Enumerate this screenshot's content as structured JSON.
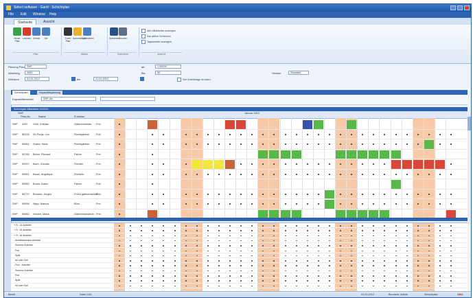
{
  "window": {
    "title": "Select software - Gantt - Schichtplan",
    "icon": "app-icon"
  },
  "menu": [
    "File",
    "Edit",
    "Window",
    "Help"
  ],
  "ribbon_tabs": [
    {
      "label": "Startseite",
      "active": true
    },
    {
      "label": "Ansicht",
      "active": false
    }
  ],
  "ribbon_buttons": [
    {
      "label": "Neuer Plan",
      "icon": "refresh-icon",
      "color": "#3aa14b"
    },
    {
      "label": "Löschen",
      "icon": "delete-icon",
      "color": "#d83b2b"
    },
    {
      "label": "Zurück",
      "icon": "back-arrow-icon",
      "color": "#4a7fc1"
    },
    {
      "label": "Vor",
      "icon": "forward-arrow-icon",
      "color": "#4a7fc1"
    },
    {
      "label": "Zoom Plan",
      "icon": "zoom-icon",
      "color": "#333333"
    },
    {
      "label": "Automatisch",
      "icon": "wand-icon",
      "color": "#e8b32a"
    },
    {
      "label": "Optimieren",
      "icon": "optimize-icon",
      "color": "#4a7fc1"
    },
    {
      "label": "Speichern",
      "icon": "save-icon",
      "color": "#2c4f86"
    },
    {
      "label": "Drucken",
      "icon": "print-icon",
      "color": "#5c6e88"
    }
  ],
  "ribbon_groups": [
    "Plan",
    "Aktion",
    "Speichern",
    "Ansicht"
  ],
  "ribbon_options": [
    "Alle Mitarbeiter anzeigen",
    "Nur aktive Schichten",
    "Tageswerte anzeigen"
  ],
  "fields": {
    "planname_label": "Planung Plan",
    "planname_value": "SHP",
    "abteilung_label": "Abteilung",
    "abteilung_value": "3460",
    "zeitraum_label": "Zeitraum",
    "zeitraum_from": "01.01.2012",
    "zeitraum_to": "31.01.2012",
    "bis_label": "bis",
    "ab_label": "ab",
    "ab_value": "1.09000",
    "bis2_label": "Bis",
    "bis2_value": "50",
    "checkbox_label": "Nur Arbeitstage drucken",
    "version_label": "Version",
    "version_value": "Standard"
  },
  "panel_tabs": [
    {
      "label": "Schichtplan",
      "active": true
    },
    {
      "label": "Kapazitätsplanung",
      "active": false
    }
  ],
  "filter": {
    "label": "Kapazitätsmodell",
    "value": "SHP-Ab"
  },
  "section_title": "Schichtplan Mitarbeiter 01/2012",
  "grid": {
    "group_label": "SHP",
    "columns": [
      "Pers-Nr.",
      "Name",
      "Funktion"
    ],
    "month_label": "Januar 2012",
    "rows": [
      {
        "grp": "SHP",
        "id": "4497",
        "name": "Grüll, Kristian",
        "role": "Gärtnermeister",
        "type": "Frei"
      },
      {
        "grp": "SHP",
        "id": "50109",
        "name": "Sh Pouja, Leo",
        "role": "Floristgärtner",
        "type": "Frei"
      },
      {
        "grp": "SHP",
        "id": "50681",
        "name": "Grabe, Hans",
        "role": "Floristgärtner",
        "type": "Frei"
      },
      {
        "grp": "SHP",
        "id": "50785",
        "name": "Bohm, Richard",
        "role": "Fahrer",
        "type": "Frei"
      },
      {
        "grp": "SHP",
        "id": "50937",
        "name": "Bach, Claudia",
        "role": "Floristin",
        "type": "Frei"
      },
      {
        "grp": "SHP",
        "id": "50951",
        "name": "Bauer, Angelique",
        "role": "Florist/in",
        "type": "Frei"
      },
      {
        "grp": "SHP",
        "id": "50952",
        "name": "Bruno, Adam",
        "role": "Fahrer",
        "type": "Frei"
      },
      {
        "grp": "SHP",
        "id": "50770",
        "name": "Brunner, Jürgen",
        "role": "Frei/a gärtnermeister",
        "type": "Frei"
      },
      {
        "grp": "SHP",
        "id": "50998",
        "name": "Wipp, Marcus",
        "role": "Büro",
        "type": "Frei"
      },
      {
        "grp": "SHP",
        "id": "50982",
        "name": "Heinen, Maria",
        "role": "Gärtnermeister/in",
        "type": "Frei"
      }
    ]
  },
  "summary_rows": [
    "+ Fr. 14 Arbeitet",
    "+ Fr. 15 Arbeitet",
    "+ Fr. 16 Arbeitet",
    "- Arbeitsstunden Arbeitet",
    "  Summe Arbeitet",
    "  Frei",
    "  Spät",
    "  Ist oder Soll",
    "- Frei - Arbeitet",
    "  Summe Arbeitet",
    "  Frei",
    "  Spät",
    "  Ist oder Soll"
  ],
  "status": {
    "left": "Bereit",
    "mid": "Datei 1/34",
    "right1": "01.01.2012",
    "right2": "Benutzer: Admin",
    "right3": "Schichtplan",
    "logo": "ABO"
  },
  "colors": {
    "weekend": "#f6c9a8",
    "green": "#56b948",
    "red": "#d9463a",
    "yellow": "#f2e63c",
    "blue": "#3551a9",
    "header_blue": "#2b62b2"
  }
}
